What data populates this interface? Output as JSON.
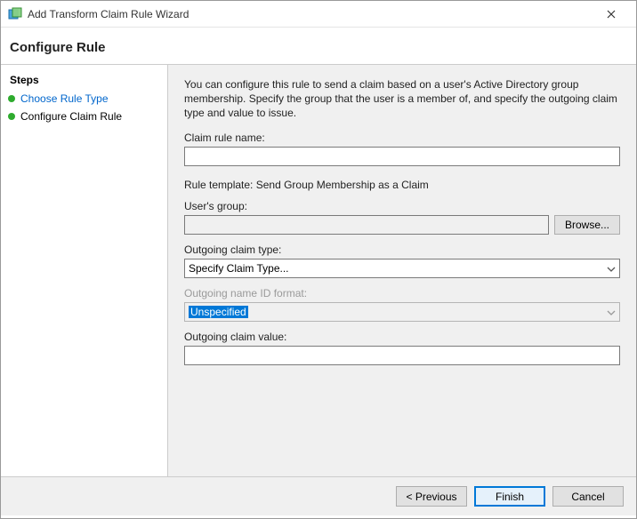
{
  "window": {
    "title": "Add Transform Claim Rule Wizard"
  },
  "header": {
    "title": "Configure Rule"
  },
  "sidebar": {
    "heading": "Steps",
    "items": [
      {
        "label": "Choose Rule Type",
        "state": "link"
      },
      {
        "label": "Configure Claim Rule",
        "state": "current"
      }
    ]
  },
  "main": {
    "description": "You can configure this rule to send a claim based on a user's Active Directory group membership. Specify the group that the user is a member of, and specify the outgoing claim type and value to issue.",
    "claim_rule_name_label": "Claim rule name:",
    "claim_rule_name_value": "",
    "rule_template_prefix": "Rule template: ",
    "rule_template_value": "Send Group Membership as a Claim",
    "users_group_label": "User's group:",
    "users_group_value": "",
    "browse_label": "Browse...",
    "outgoing_claim_type_label": "Outgoing claim type:",
    "outgoing_claim_type_value": "Specify Claim Type...",
    "outgoing_name_id_label": "Outgoing name ID format:",
    "outgoing_name_id_value": "Unspecified",
    "outgoing_claim_value_label": "Outgoing claim value:",
    "outgoing_claim_value_value": ""
  },
  "footer": {
    "previous": "< Previous",
    "finish": "Finish",
    "cancel": "Cancel"
  }
}
